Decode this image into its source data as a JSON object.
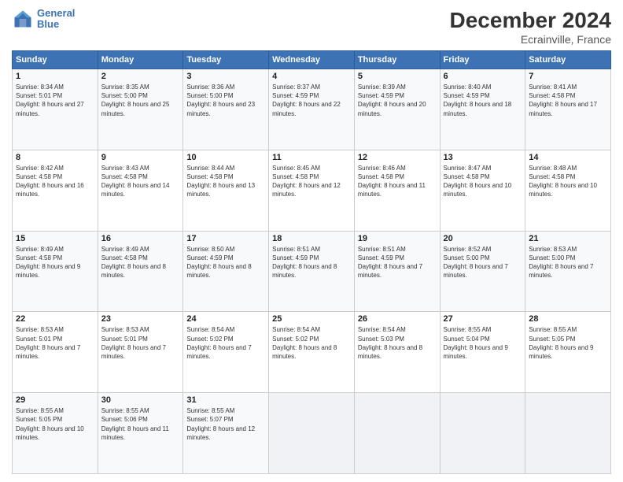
{
  "header": {
    "logo_line1": "General",
    "logo_line2": "Blue",
    "title": "December 2024",
    "subtitle": "Ecrainville, France"
  },
  "columns": [
    "Sunday",
    "Monday",
    "Tuesday",
    "Wednesday",
    "Thursday",
    "Friday",
    "Saturday"
  ],
  "weeks": [
    [
      {
        "day": "1",
        "sunrise": "8:34 AM",
        "sunset": "5:01 PM",
        "daylight": "8 hours and 27 minutes."
      },
      {
        "day": "2",
        "sunrise": "8:35 AM",
        "sunset": "5:00 PM",
        "daylight": "8 hours and 25 minutes."
      },
      {
        "day": "3",
        "sunrise": "8:36 AM",
        "sunset": "5:00 PM",
        "daylight": "8 hours and 23 minutes."
      },
      {
        "day": "4",
        "sunrise": "8:37 AM",
        "sunset": "4:59 PM",
        "daylight": "8 hours and 22 minutes."
      },
      {
        "day": "5",
        "sunrise": "8:39 AM",
        "sunset": "4:59 PM",
        "daylight": "8 hours and 20 minutes."
      },
      {
        "day": "6",
        "sunrise": "8:40 AM",
        "sunset": "4:59 PM",
        "daylight": "8 hours and 18 minutes."
      },
      {
        "day": "7",
        "sunrise": "8:41 AM",
        "sunset": "4:58 PM",
        "daylight": "8 hours and 17 minutes."
      }
    ],
    [
      {
        "day": "8",
        "sunrise": "8:42 AM",
        "sunset": "4:58 PM",
        "daylight": "8 hours and 16 minutes."
      },
      {
        "day": "9",
        "sunrise": "8:43 AM",
        "sunset": "4:58 PM",
        "daylight": "8 hours and 14 minutes."
      },
      {
        "day": "10",
        "sunrise": "8:44 AM",
        "sunset": "4:58 PM",
        "daylight": "8 hours and 13 minutes."
      },
      {
        "day": "11",
        "sunrise": "8:45 AM",
        "sunset": "4:58 PM",
        "daylight": "8 hours and 12 minutes."
      },
      {
        "day": "12",
        "sunrise": "8:46 AM",
        "sunset": "4:58 PM",
        "daylight": "8 hours and 11 minutes."
      },
      {
        "day": "13",
        "sunrise": "8:47 AM",
        "sunset": "4:58 PM",
        "daylight": "8 hours and 10 minutes."
      },
      {
        "day": "14",
        "sunrise": "8:48 AM",
        "sunset": "4:58 PM",
        "daylight": "8 hours and 10 minutes."
      }
    ],
    [
      {
        "day": "15",
        "sunrise": "8:49 AM",
        "sunset": "4:58 PM",
        "daylight": "8 hours and 9 minutes."
      },
      {
        "day": "16",
        "sunrise": "8:49 AM",
        "sunset": "4:58 PM",
        "daylight": "8 hours and 8 minutes."
      },
      {
        "day": "17",
        "sunrise": "8:50 AM",
        "sunset": "4:59 PM",
        "daylight": "8 hours and 8 minutes."
      },
      {
        "day": "18",
        "sunrise": "8:51 AM",
        "sunset": "4:59 PM",
        "daylight": "8 hours and 8 minutes."
      },
      {
        "day": "19",
        "sunrise": "8:51 AM",
        "sunset": "4:59 PM",
        "daylight": "8 hours and 7 minutes."
      },
      {
        "day": "20",
        "sunrise": "8:52 AM",
        "sunset": "5:00 PM",
        "daylight": "8 hours and 7 minutes."
      },
      {
        "day": "21",
        "sunrise": "8:53 AM",
        "sunset": "5:00 PM",
        "daylight": "8 hours and 7 minutes."
      }
    ],
    [
      {
        "day": "22",
        "sunrise": "8:53 AM",
        "sunset": "5:01 PM",
        "daylight": "8 hours and 7 minutes."
      },
      {
        "day": "23",
        "sunrise": "8:53 AM",
        "sunset": "5:01 PM",
        "daylight": "8 hours and 7 minutes."
      },
      {
        "day": "24",
        "sunrise": "8:54 AM",
        "sunset": "5:02 PM",
        "daylight": "8 hours and 7 minutes."
      },
      {
        "day": "25",
        "sunrise": "8:54 AM",
        "sunset": "5:02 PM",
        "daylight": "8 hours and 8 minutes."
      },
      {
        "day": "26",
        "sunrise": "8:54 AM",
        "sunset": "5:03 PM",
        "daylight": "8 hours and 8 minutes."
      },
      {
        "day": "27",
        "sunrise": "8:55 AM",
        "sunset": "5:04 PM",
        "daylight": "8 hours and 9 minutes."
      },
      {
        "day": "28",
        "sunrise": "8:55 AM",
        "sunset": "5:05 PM",
        "daylight": "8 hours and 9 minutes."
      }
    ],
    [
      {
        "day": "29",
        "sunrise": "8:55 AM",
        "sunset": "5:05 PM",
        "daylight": "8 hours and 10 minutes."
      },
      {
        "day": "30",
        "sunrise": "8:55 AM",
        "sunset": "5:06 PM",
        "daylight": "8 hours and 11 minutes."
      },
      {
        "day": "31",
        "sunrise": "8:55 AM",
        "sunset": "5:07 PM",
        "daylight": "8 hours and 12 minutes."
      },
      null,
      null,
      null,
      null
    ]
  ]
}
